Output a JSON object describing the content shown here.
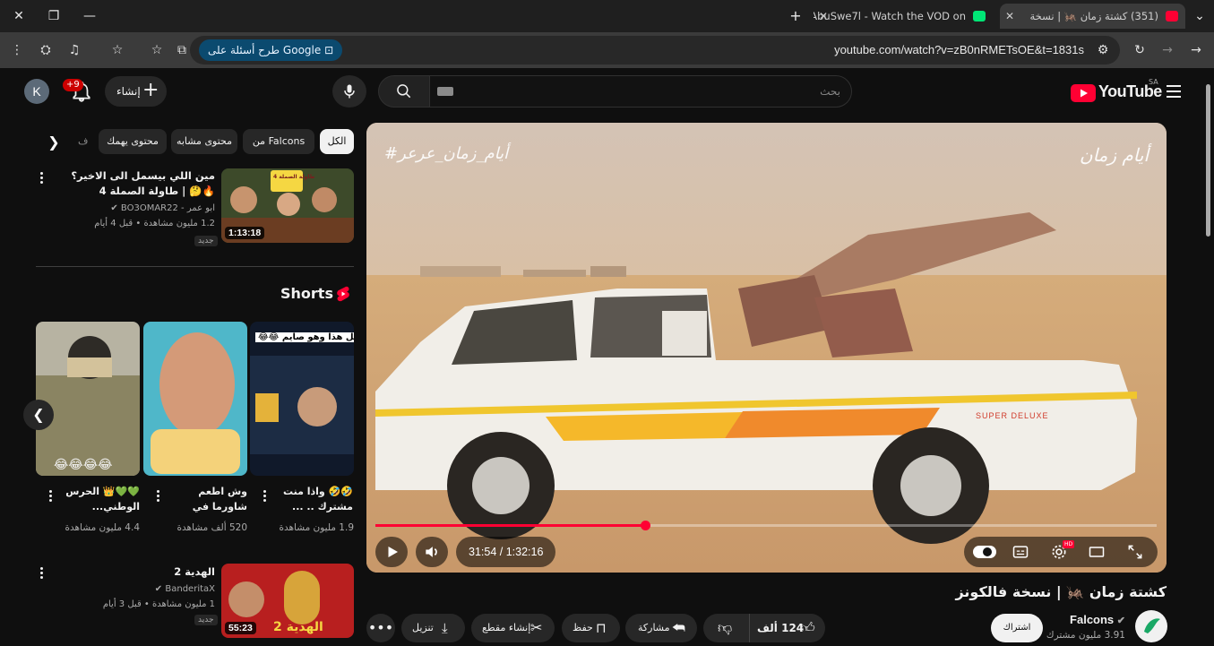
{
  "browser": {
    "tabs": [
      {
        "title": "(351) كشتة زمان 🦗 | نسخة",
        "active": true
      },
      {
        "title": "AbuSwe7l - Watch the VOD on",
        "active": false
      }
    ],
    "new_tab": "+",
    "url": "youtube.com/watch?v=zB0nRMETsOE&t=1831s",
    "google_chip": "طرح أسئلة على Google"
  },
  "header": {
    "avatar_letter": "K",
    "notif_count": "+9",
    "create_label": "إنشاء",
    "search_placeholder": "بحث",
    "logo_text": "YouTube",
    "logo_region": "SA"
  },
  "player": {
    "overlay_left": "#أيام_زمان_عرعر",
    "overlay_right": "أيام زمان",
    "brand_text": "SUPER DELUXE",
    "current_time": "31:54",
    "duration": "1:32:16",
    "progress_fraction": 0.345
  },
  "video": {
    "title": "كشتة زمان 🦗 | نسخة فالكونز",
    "channel": "Falcons",
    "subscribers": "3.91 مليون مشترك",
    "subscribe_label": "اشتراك",
    "likes": "124 ألف",
    "share_label": "مشاركة",
    "save_label": "حفظ",
    "clip_label": "إنشاء مقطع",
    "download_label": "تنزيل"
  },
  "sidebar": {
    "chips": [
      "الكل",
      "من Falcons",
      "محتوى مشابه",
      "محتوى يهمك",
      "ف"
    ],
    "top_video": {
      "title": "مين اللي بيسمل الى الاخير؟ 🔥🤔 | طاولة الصملة 4",
      "channel": "ابو عمر - BO3OMAR22",
      "meta": "1.2 مليون مشاهدة • قبل 4 أيام",
      "badge": "جديد",
      "duration": "1:13:18",
      "thumb_text": "طاولة الصملة 4"
    },
    "shorts_heading": "Shorts",
    "shorts": [
      {
        "title": "💚💚👑 الحرس الوطني...",
        "views": "4.4 مليون مشاهدة",
        "overlay": "😂😂😂😂"
      },
      {
        "title": "وش اطعم شاورما في السعوديه ؟ SA",
        "views": "520 ألف مشاهدة",
        "overlay": ""
      },
      {
        "title": "🤣🤣 واذا منت مشترك .. ...",
        "views": "1.9 مليون مشاهدة",
        "overlay": "كل هذا وهو صايم 😂😂"
      }
    ],
    "bottom_video": {
      "title": "الهدية 2",
      "channel": "BanderitaX",
      "meta": "1 مليون مشاهدة • قبل 3 أيام",
      "badge": "جديد",
      "duration": "55:23",
      "thumb_text": "الهدية 2"
    }
  }
}
